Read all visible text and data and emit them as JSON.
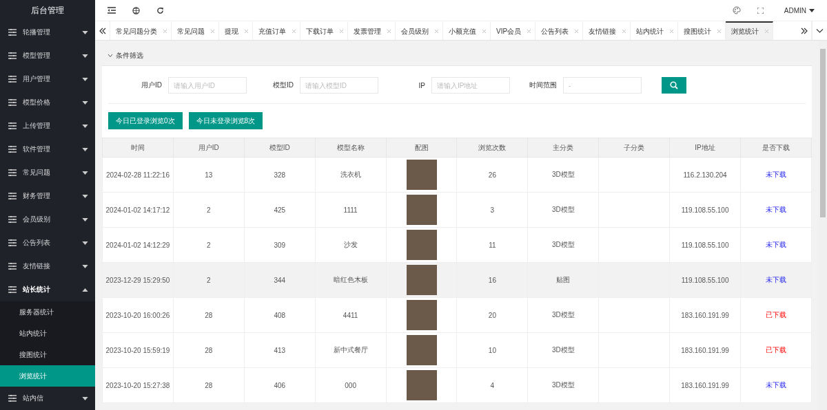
{
  "sidebar": {
    "title": "后台管理",
    "items": [
      {
        "label": "轮播管理",
        "expanded": false
      },
      {
        "label": "模型管理",
        "expanded": false
      },
      {
        "label": "用户管理",
        "expanded": false
      },
      {
        "label": "模型价格",
        "expanded": false
      },
      {
        "label": "上传管理",
        "expanded": false
      },
      {
        "label": "软件管理",
        "expanded": false
      },
      {
        "label": "常见问题",
        "expanded": false
      },
      {
        "label": "财务管理",
        "expanded": false
      },
      {
        "label": "会员级别",
        "expanded": false
      },
      {
        "label": "公告列表",
        "expanded": false
      },
      {
        "label": "友情链接",
        "expanded": false
      },
      {
        "label": "站长统计",
        "expanded": true,
        "children": [
          {
            "label": "服务器统计",
            "selected": false
          },
          {
            "label": "站内统计",
            "selected": false
          },
          {
            "label": "搜图统计",
            "selected": false
          },
          {
            "label": "浏览统计",
            "selected": true
          }
        ]
      },
      {
        "label": "站内信",
        "expanded": false
      }
    ]
  },
  "header": {
    "user": "ADMIN"
  },
  "tabs": [
    {
      "label": "常见问题分类",
      "selected": false
    },
    {
      "label": "常见问题",
      "selected": false
    },
    {
      "label": "提现",
      "selected": false
    },
    {
      "label": "充值订单",
      "selected": false
    },
    {
      "label": "下载订单",
      "selected": false
    },
    {
      "label": "发票管理",
      "selected": false
    },
    {
      "label": "会员级别",
      "selected": false
    },
    {
      "label": "小额充值",
      "selected": false
    },
    {
      "label": "VIP会员",
      "selected": false
    },
    {
      "label": "公告列表",
      "selected": false
    },
    {
      "label": "友情链接",
      "selected": false
    },
    {
      "label": "站内统计",
      "selected": false
    },
    {
      "label": "搜图统计",
      "selected": false
    },
    {
      "label": "浏览统计",
      "selected": true
    }
  ],
  "filter": {
    "title": "条件筛选",
    "expanded": true,
    "fields": [
      {
        "label": "用户ID",
        "placeholder": "请输入用户ID"
      },
      {
        "label": "模型ID",
        "placeholder": "请输入模型ID"
      },
      {
        "label": "IP",
        "placeholder": "请输入IP地址"
      },
      {
        "label": "时间范围",
        "placeholder": "-"
      }
    ]
  },
  "stat_buttons": [
    "今日已登录浏览0次",
    "今日未登录浏览8次"
  ],
  "table": {
    "columns": [
      "时间",
      "用户ID",
      "模型ID",
      "模型名称",
      "配图",
      "浏览次数",
      "主分类",
      "子分类",
      "IP地址",
      "是否下载"
    ],
    "rows": [
      {
        "time": "2024-02-28 11:22:16",
        "user_id": "13",
        "model_id": "328",
        "model_name": "洗衣机",
        "views": "26",
        "category": "3D模型",
        "ip": "116.2.130.204",
        "download": "未下载",
        "downloaded": false,
        "selected": false
      },
      {
        "time": "2024-01-02 14:17:12",
        "user_id": "2",
        "model_id": "425",
        "model_name": "1111",
        "views": "3",
        "category": "3D模型",
        "ip": "119.108.55.100",
        "download": "未下载",
        "downloaded": false,
        "selected": false
      },
      {
        "time": "2024-01-02 14:12:29",
        "user_id": "2",
        "model_id": "309",
        "model_name": "沙发",
        "views": "11",
        "category": "3D模型",
        "ip": "119.108.55.100",
        "download": "未下载",
        "downloaded": false,
        "selected": false
      },
      {
        "time": "2023-12-29 15:29:50",
        "user_id": "2",
        "model_id": "344",
        "model_name": "暗红色木板",
        "views": "16",
        "category": "贴图",
        "ip": "119.108.55.100",
        "download": "未下载",
        "downloaded": false,
        "selected": true
      },
      {
        "time": "2023-10-20 16:00:26",
        "user_id": "28",
        "model_id": "408",
        "model_name": "4411",
        "views": "20",
        "category": "3D模型",
        "ip": "183.160.191.99",
        "download": "已下载",
        "downloaded": true,
        "selected": false
      },
      {
        "time": "2023-10-20 15:59:19",
        "user_id": "28",
        "model_id": "413",
        "model_name": "新中式餐厅",
        "views": "10",
        "category": "3D模型",
        "ip": "183.160.191.99",
        "download": "已下载",
        "downloaded": true,
        "selected": false
      },
      {
        "time": "2023-10-20 15:27:38",
        "user_id": "28",
        "model_id": "406",
        "model_name": "000",
        "views": "4",
        "category": "3D模型",
        "ip": "183.160.191.99",
        "download": "未下载",
        "downloaded": false,
        "selected": false
      }
    ]
  }
}
